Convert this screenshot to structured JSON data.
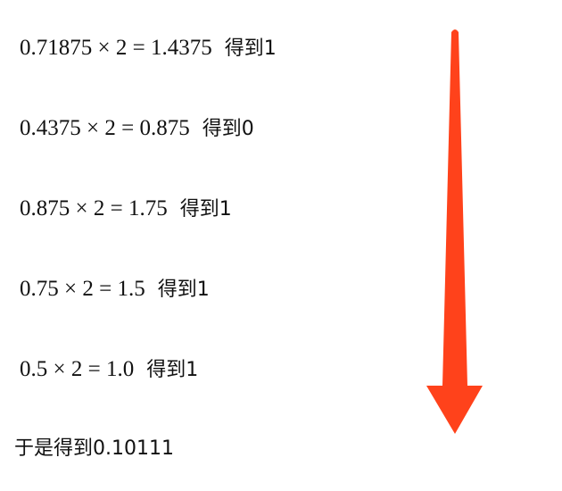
{
  "steps": [
    {
      "equation": "0.71875 × 2 = 1.4375",
      "result": "得到1"
    },
    {
      "equation": "0.4375 × 2 = 0.875",
      "result": "得到0"
    },
    {
      "equation": "0.875 × 2 = 1.75",
      "result": "得到1"
    },
    {
      "equation": "0.75 × 2 = 1.5",
      "result": "得到1"
    },
    {
      "equation": "0.5 × 2 = 1.0",
      "result": "得到1"
    }
  ],
  "summary": "于是得到0.10111",
  "arrow": {
    "icon": "arrow-down-icon",
    "color": "#FF421B"
  }
}
